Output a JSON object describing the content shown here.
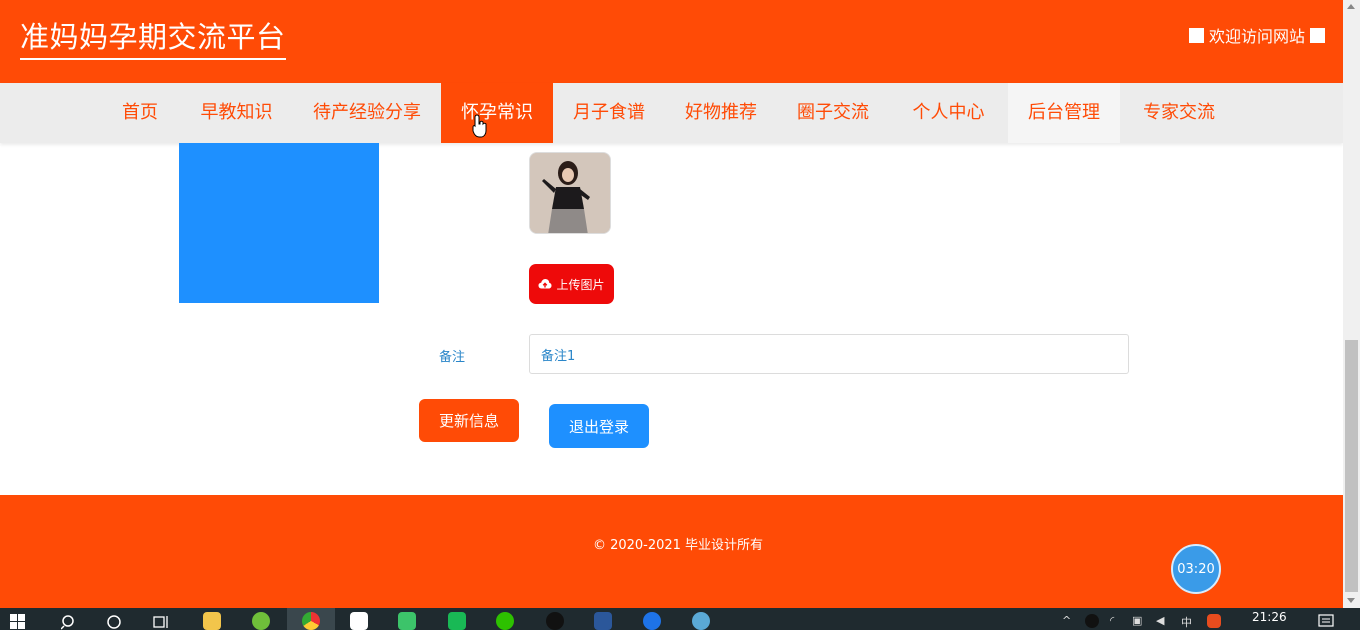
{
  "header": {
    "site_title": "准妈妈孕期交流平台",
    "welcome": "欢迎访问网站"
  },
  "nav": {
    "items": [
      {
        "label": "首页"
      },
      {
        "label": "早教知识"
      },
      {
        "label": "待产经验分享"
      },
      {
        "label": "怀孕常识"
      },
      {
        "label": "月子食谱"
      },
      {
        "label": "好物推荐"
      },
      {
        "label": "圈子交流"
      },
      {
        "label": "个人中心"
      },
      {
        "label": "后台管理"
      },
      {
        "label": "专家交流"
      }
    ],
    "active_label": "怀孕常识"
  },
  "form": {
    "upload_label": "上传图片",
    "note_label": "备注",
    "note_value": "备注1",
    "update_label": "更新信息",
    "logout_label": "退出登录"
  },
  "footer": {
    "copyright": "© 2020-2021 毕业设计所有",
    "timer": "03:20"
  },
  "taskbar": {
    "clock": "21:26",
    "ime": "中"
  },
  "colors": {
    "brand": "#ff4b06",
    "blue": "#1e90ff",
    "upload_red": "#ee0a0a"
  }
}
